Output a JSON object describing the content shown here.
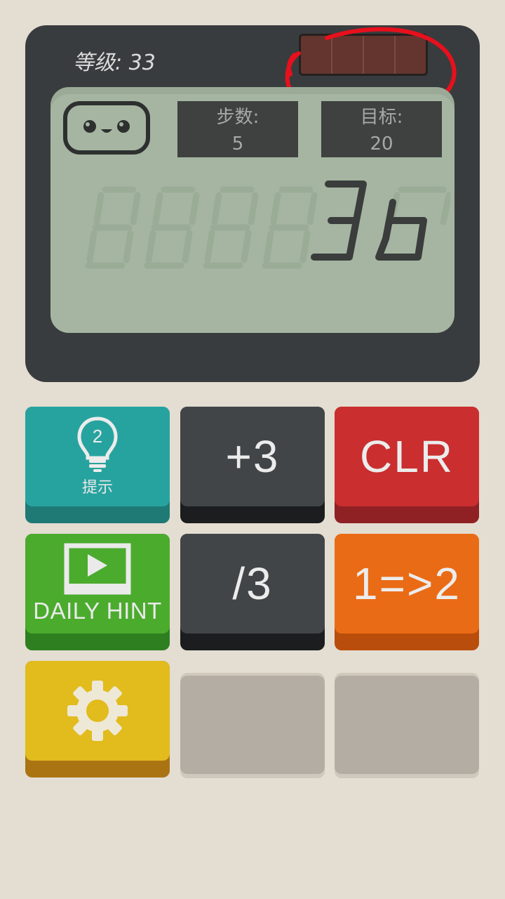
{
  "header": {
    "level_text": "等级: 33"
  },
  "display": {
    "moves_label": "步数:",
    "moves_value": "5",
    "goal_label": "目标:",
    "goal_value": "20",
    "current_value": "36"
  },
  "keys": {
    "hint_label": "提示",
    "hint_count": "2",
    "plus3_label": "+3",
    "clr_label": "CLR",
    "daily_hint_label": "DAILY HINT",
    "div3_label": "/3",
    "replace_label": "1=>2"
  },
  "colors": {
    "annotation": "#e8101c",
    "hint": "#27a39f",
    "clr": "#ca2e2f",
    "daily_hint": "#4bab2d",
    "replace": "#ea6b15",
    "settings": "#e2bb1c",
    "operator": "#424547"
  },
  "icons": [
    "robot-face-icon",
    "lightbulb-icon",
    "play-video-icon",
    "gear-icon"
  ]
}
